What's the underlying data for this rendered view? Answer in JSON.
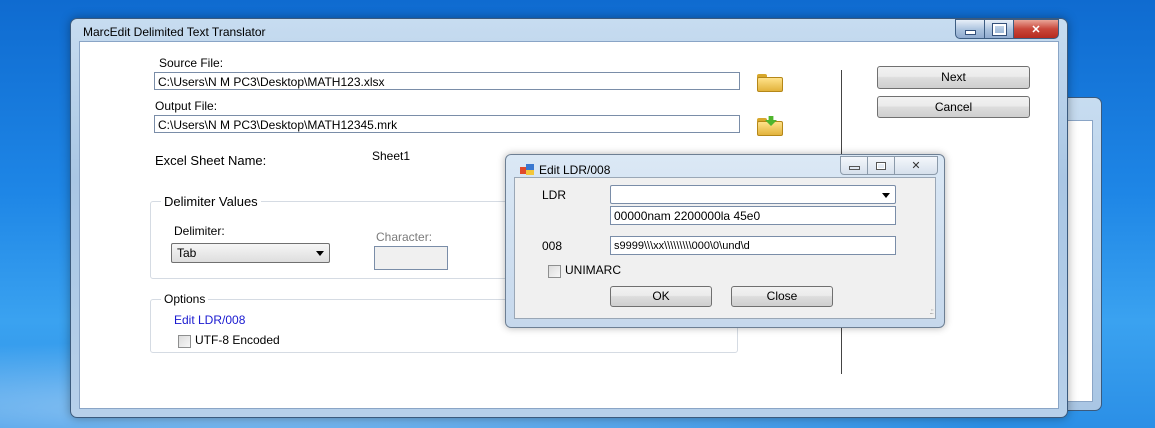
{
  "main_window": {
    "title": "MarcEdit Delimited Text Translator",
    "source_file_label": "Source File:",
    "source_file_value": "C:\\Users\\N M PC3\\Desktop\\MATH123.xlsx",
    "output_file_label": "Output File:",
    "output_file_value": "C:\\Users\\N M PC3\\Desktop\\MATH12345.mrk",
    "excel_sheet_label": "Excel Sheet Name:",
    "excel_sheet_value": "Sheet1",
    "delimiter_group_title": "Delimiter Values",
    "delimiter_label": "Delimiter:",
    "delimiter_value": "Tab",
    "character_label": "Character:",
    "options_group_title": "Options",
    "edit_ldr_link": "Edit LDR/008",
    "utf8_label": "UTF-8 Encoded",
    "next_button": "Next",
    "cancel_button": "Cancel"
  },
  "dialog": {
    "title": "Edit LDR/008",
    "ldr_label": "LDR",
    "ldr_dropdown_value": "",
    "ldr_value": "00000nam  2200000la 45e0",
    "field_008_label": "008",
    "field_008_value": "s9999\\\\\\xx\\\\\\\\\\\\\\\\\\000\\0\\und\\d",
    "unimarc_label": "UNIMARC",
    "ok_button": "OK",
    "close_button": "Close"
  },
  "colors": {
    "link": "#1a1ad0",
    "title_close": "#c9473a",
    "desktop": "#1e86e6"
  }
}
